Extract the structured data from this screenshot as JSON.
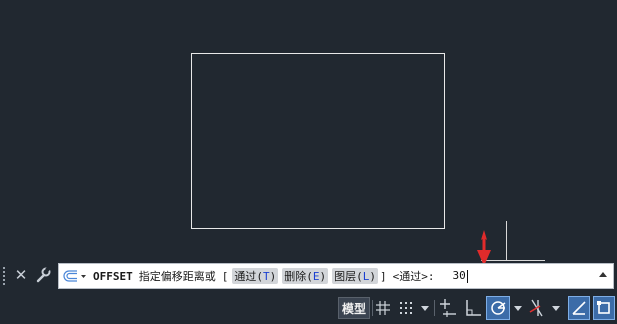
{
  "command_line": {
    "recent_icon": "recent-commands-icon",
    "command": "OFFSET",
    "prompt": "指定偏移距离或",
    "bracket_open": "[",
    "bracket_close": "]",
    "options": [
      {
        "label": "通过",
        "key": "T"
      },
      {
        "label": "删除",
        "key": "E"
      },
      {
        "label": "图层",
        "key": "L"
      }
    ],
    "default": "<通过>:",
    "input_value": "30"
  },
  "status_bar": {
    "model_label": "模型",
    "icons": [
      "grid-icon",
      "snap-icon",
      "snap-dropdown-icon",
      "dynamic-input-icon",
      "ortho-icon",
      "polar-tracking-icon",
      "polar-dropdown-icon",
      "isodraft-icon",
      "isodraft-dropdown-icon",
      "object-snap-tracking-icon",
      "object-snap-icon"
    ]
  },
  "colors": {
    "background": "#212830",
    "accent_active": "#3c6ca8",
    "option_key": "#1a3fd1",
    "arrow": "#e02b2b"
  }
}
